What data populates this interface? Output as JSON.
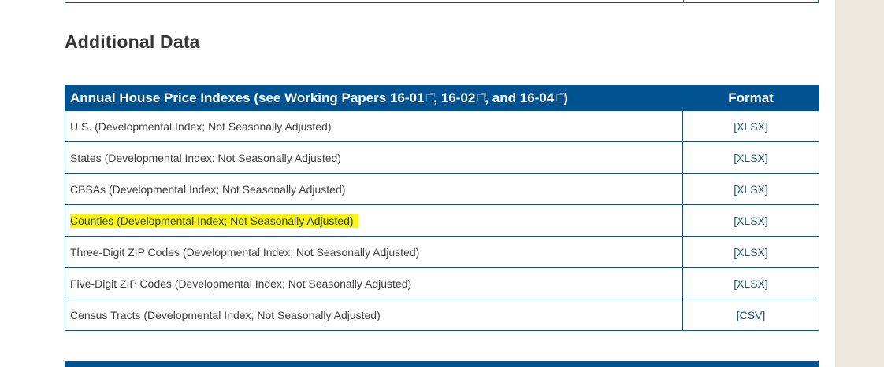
{
  "section": {
    "title": "Additional Data"
  },
  "table": {
    "header": {
      "title_parts": [
        "Annual House Price Indexes (see Working Papers ",
        "16-01",
        ", ",
        "16-02",
        ", and ",
        "16-04",
        ")"
      ],
      "format_label": "Format"
    },
    "rows": [
      {
        "label": "U.S. (Developmental Index; Not Seasonally Adjusted)",
        "format": "[XLSX]",
        "highlighted": false
      },
      {
        "label": "States (Developmental Index; Not Seasonally Adjusted)",
        "format": "[XLSX]",
        "highlighted": false
      },
      {
        "label": "CBSAs (Developmental Index; Not Seasonally Adjusted)",
        "format": "[XLSX]",
        "highlighted": false
      },
      {
        "label": "Counties (Developmental Index; Not Seasonally Adjusted)",
        "format": "[XLSX]",
        "highlighted": true
      },
      {
        "label": "Three-Digit ZIP Codes (Developmental Index; Not Seasonally Adjusted)",
        "format": "[XLSX]",
        "highlighted": false
      },
      {
        "label": "Five-Digit ZIP Codes (Developmental Index; Not Seasonally Adjusted)",
        "format": "[XLSX]",
        "highlighted": false
      },
      {
        "label": "Census Tracts (Developmental Index; Not Seasonally Adjusted)",
        "format": "[CSV]",
        "highlighted": false
      }
    ]
  },
  "colors": {
    "header_bg": "#005291",
    "border": "#1f4e79",
    "highlight": "#f5f51a",
    "rail": "#ebe6de"
  },
  "icons": {
    "external_link": "external-link-icon"
  }
}
